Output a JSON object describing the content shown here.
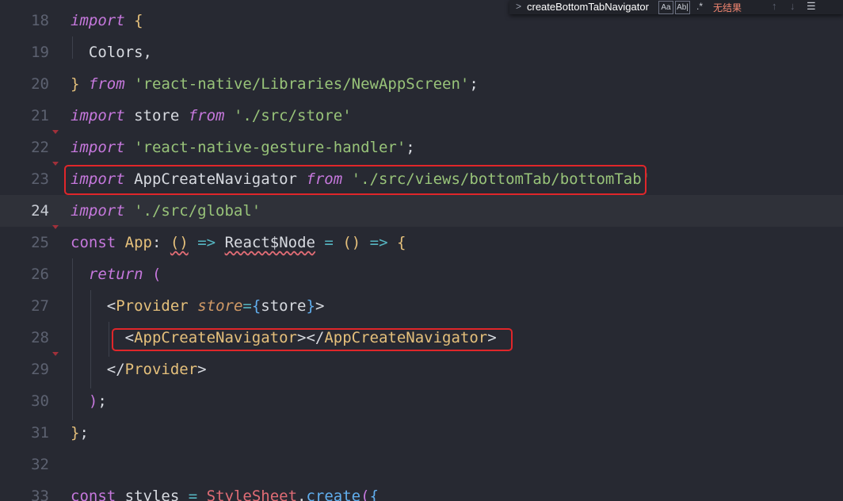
{
  "find_widget": {
    "toggle_icon": "chevron-right-icon",
    "query": "createBottomTabNavigator",
    "match_case_label": "Aa",
    "whole_word_label": "Ab|",
    "regex_label": ".*",
    "result_text": "无结果",
    "prev_icon": "↑",
    "next_icon": "↓",
    "menu_icon": "☰"
  },
  "colors": {
    "background": "#272932",
    "highlight_box": "#e0262a",
    "keyword": "#c678dd",
    "string": "#98c379"
  },
  "lines": [
    {
      "num": "18",
      "tokens": [
        [
          "k",
          "import"
        ],
        [
          "id",
          " "
        ],
        [
          "p",
          "{"
        ]
      ]
    },
    {
      "num": "19",
      "tokens": [
        [
          "id",
          "  Colors,"
        ]
      ]
    },
    {
      "num": "20",
      "tokens": [
        [
          "p",
          "}"
        ],
        [
          "id",
          " "
        ],
        [
          "k",
          "from"
        ],
        [
          "id",
          " "
        ],
        [
          "s",
          "'react-native/Libraries/NewAppScreen'"
        ],
        [
          "id",
          ";"
        ]
      ]
    },
    {
      "num": "21",
      "tokens": [
        [
          "k",
          "import"
        ],
        [
          "id",
          " store "
        ],
        [
          "k",
          "from"
        ],
        [
          "id",
          " "
        ],
        [
          "s",
          "'./src/store'"
        ]
      ]
    },
    {
      "num": "22",
      "tokens": [
        [
          "k",
          "import"
        ],
        [
          "id",
          " "
        ],
        [
          "s",
          "'react-native-gesture-handler'"
        ],
        [
          "id",
          ";"
        ]
      ]
    },
    {
      "num": "23",
      "tokens": [
        [
          "k",
          "import"
        ],
        [
          "id",
          " AppCreateNavigator "
        ],
        [
          "k",
          "from"
        ],
        [
          "id",
          " "
        ],
        [
          "s",
          "'./src/views/bottomTab/bottomTab'"
        ]
      ]
    },
    {
      "num": "24",
      "tokens": [
        [
          "k",
          "import"
        ],
        [
          "id",
          " "
        ],
        [
          "s",
          "'./src/global'"
        ]
      ]
    },
    {
      "num": "25",
      "tokens": [
        [
          "kn",
          "const"
        ],
        [
          "id",
          " "
        ],
        [
          "t",
          "App"
        ],
        [
          "id",
          ": "
        ],
        [
          "pw",
          "()"
        ],
        [
          "id",
          " "
        ],
        [
          "op",
          "=>"
        ],
        [
          "id",
          " "
        ],
        [
          "idw",
          "React$Node"
        ],
        [
          "id",
          " "
        ],
        [
          "op",
          "="
        ],
        [
          "id",
          " "
        ],
        [
          "p",
          "()"
        ],
        [
          "id",
          " "
        ],
        [
          "op",
          "=>"
        ],
        [
          "id",
          " "
        ],
        [
          "p",
          "{"
        ]
      ]
    },
    {
      "num": "26",
      "tokens": [
        [
          "id",
          "  "
        ],
        [
          "k",
          "return"
        ],
        [
          "id",
          " "
        ],
        [
          "pm",
          "("
        ]
      ]
    },
    {
      "num": "27",
      "tokens": [
        [
          "id",
          "    "
        ],
        [
          "id",
          "<"
        ],
        [
          "t",
          "Provider"
        ],
        [
          "id",
          " "
        ],
        [
          "attr",
          "store"
        ],
        [
          "op",
          "="
        ],
        [
          "pb",
          "{"
        ],
        [
          "id",
          "store"
        ],
        [
          "pb",
          "}"
        ],
        [
          "id",
          ">"
        ]
      ]
    },
    {
      "num": "28",
      "tokens": [
        [
          "id",
          "      "
        ],
        [
          "id",
          "<"
        ],
        [
          "t",
          "AppCreateNavigator"
        ],
        [
          "id",
          "></"
        ],
        [
          "t",
          "AppCreateNavigator"
        ],
        [
          "id",
          ">"
        ]
      ]
    },
    {
      "num": "29",
      "tokens": [
        [
          "id",
          "    "
        ],
        [
          "id",
          "</"
        ],
        [
          "t",
          "Provider"
        ],
        [
          "id",
          ">"
        ]
      ]
    },
    {
      "num": "30",
      "tokens": [
        [
          "id",
          "  "
        ],
        [
          "pm",
          ")"
        ],
        [
          "id",
          ";"
        ]
      ]
    },
    {
      "num": "31",
      "tokens": [
        [
          "p",
          "}"
        ],
        [
          "id",
          ";"
        ]
      ]
    },
    {
      "num": "32",
      "tokens": []
    },
    {
      "num": "33",
      "tokens": [
        [
          "kn",
          "const"
        ],
        [
          "id",
          " styles "
        ],
        [
          "op",
          "="
        ],
        [
          "id",
          " "
        ],
        [
          "cls",
          "StyleSheet"
        ],
        [
          "id",
          "."
        ],
        [
          "fn",
          "create"
        ],
        [
          "pm",
          "("
        ],
        [
          "pb",
          "{"
        ]
      ]
    }
  ]
}
